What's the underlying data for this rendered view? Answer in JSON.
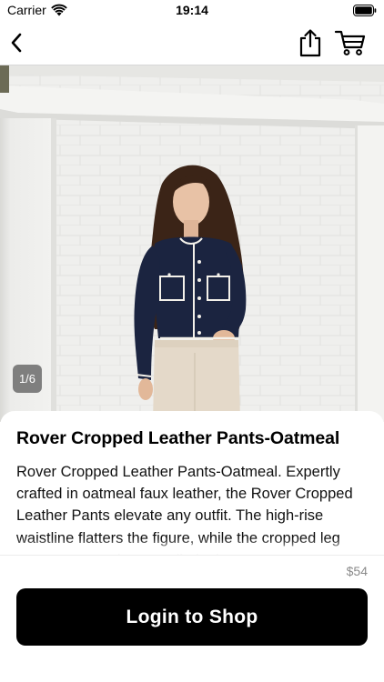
{
  "status_bar": {
    "carrier": "Carrier",
    "time": "19:14",
    "wifi_icon": "wifi-icon",
    "battery_icon": "battery-icon"
  },
  "nav": {
    "back_icon": "chevron-left-icon",
    "share_icon": "share-icon",
    "cart_icon": "cart-icon"
  },
  "product": {
    "image_counter": "1/6",
    "title": "Rover Cropped Leather Pants-Oatmeal",
    "description": "Rover Cropped Leather Pants-Oatmeal. Expertly crafted in oatmeal faux leather, the Rover Cropped Leather Pants elevate any outfit. The high-rise waistline flatters the figure, while the cropped leg ensures a trendy, versatile look.",
    "price": "$54"
  },
  "actions": {
    "login_label": "Login to Shop"
  },
  "colors": {
    "button_bg": "#000000",
    "sweater": "#1b2440",
    "pants": "#e4d9c9",
    "wall": "#eeeeec"
  }
}
